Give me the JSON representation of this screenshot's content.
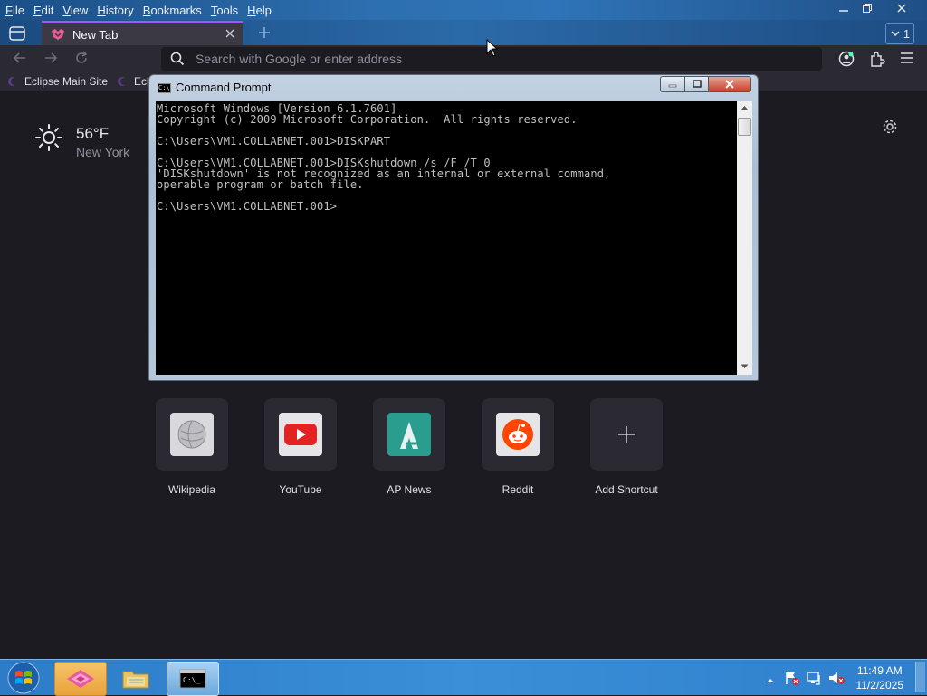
{
  "menu": [
    {
      "mnemonic": "F",
      "rest": "ile"
    },
    {
      "mnemonic": "E",
      "rest": "dit"
    },
    {
      "mnemonic": "V",
      "rest": "iew"
    },
    {
      "mnemonic": "H",
      "rest": "istory"
    },
    {
      "mnemonic": "B",
      "rest": "ookmarks"
    },
    {
      "mnemonic": "T",
      "rest": "ools"
    },
    {
      "mnemonic": "H",
      "rest": "elp"
    }
  ],
  "tab": {
    "title": "New Tab"
  },
  "tab_count": "1",
  "urlbar": {
    "placeholder": "Search with Google or enter address"
  },
  "bookmarks": [
    {
      "label": "Eclipse Main Site"
    },
    {
      "label": "Ecli"
    }
  ],
  "weather": {
    "temperature": "56°F",
    "city": "New York"
  },
  "shortcuts": [
    {
      "label": "Wikipedia",
      "icon": "wikipedia-icon"
    },
    {
      "label": "YouTube",
      "icon": "youtube-icon"
    },
    {
      "label": "AP News",
      "icon": "apnews-icon"
    },
    {
      "label": "Reddit",
      "icon": "reddit-icon"
    },
    {
      "label": "Add Shortcut",
      "icon": "plus-icon"
    }
  ],
  "cmd": {
    "title": "Command Prompt",
    "lines": [
      "Microsoft Windows [Version 6.1.7601]",
      "Copyright (c) 2009 Microsoft Corporation.  All rights reserved.",
      "",
      "C:\\Users\\VM1.COLLABNET.001>DISKPART",
      "",
      "C:\\Users\\VM1.COLLABNET.001>DISKshutdown /s /F /T 0",
      "'DISKshutdown' is not recognized as an internal or external command,",
      "operable program or batch file.",
      "",
      "C:\\Users\\VM1.COLLABNET.001>"
    ]
  },
  "clock": {
    "time": "11:49 AM",
    "date": "11/2/2025"
  },
  "colors": {
    "accent": "#a855f7",
    "page_bg": "#1c1b22",
    "taskbar": "#3a8fd8"
  }
}
